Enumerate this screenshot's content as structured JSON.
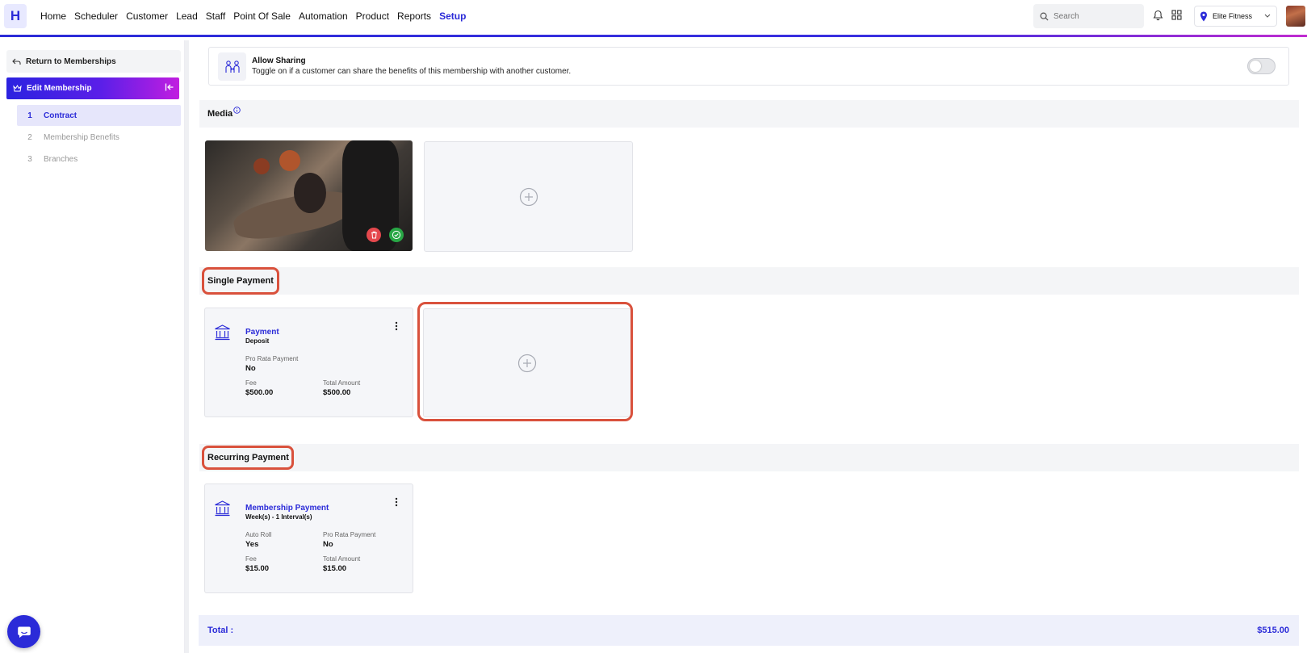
{
  "brand": {
    "logo_letter": "H",
    "accent": "#2b2bd8"
  },
  "nav": {
    "items": [
      "Home",
      "Scheduler",
      "Customer",
      "Lead",
      "Staff",
      "Point Of Sale",
      "Automation",
      "Product",
      "Reports",
      "Setup"
    ],
    "active": "Setup"
  },
  "search": {
    "placeholder": "Search"
  },
  "location": {
    "name": "Elite Fitness"
  },
  "sidebar": {
    "return_label": "Return to Memberships",
    "edit_label": "Edit Membership",
    "steps": [
      {
        "num": "1",
        "label": "Contract",
        "active": true
      },
      {
        "num": "2",
        "label": "Membership Benefits",
        "active": false
      },
      {
        "num": "3",
        "label": "Branches",
        "active": false
      }
    ]
  },
  "sharing": {
    "title": "Allow Sharing",
    "description": "Toggle on if a customer can share the benefits of this membership with another customer.",
    "enabled": false
  },
  "media": {
    "title": "Media",
    "info_icon": "info-icon"
  },
  "single_payment": {
    "title": "Single Payment",
    "card": {
      "title": "Payment",
      "subtitle": "Deposit",
      "pro_rata_label": "Pro Rata Payment",
      "pro_rata_value": "No",
      "fee_label": "Fee",
      "fee_value": "$500.00",
      "total_label": "Total Amount",
      "total_value": "$500.00"
    }
  },
  "recurring_payment": {
    "title": "Recurring Payment",
    "card": {
      "title": "Membership Payment",
      "subtitle": "Week(s) - 1 Interval(s)",
      "auto_roll_label": "Auto Roll",
      "auto_roll_value": "Yes",
      "pro_rata_label": "Pro Rata Payment",
      "pro_rata_value": "No",
      "fee_label": "Fee",
      "fee_value": "$15.00",
      "total_label": "Total Amount",
      "total_value": "$15.00"
    }
  },
  "total": {
    "label": "Total :",
    "value": "$515.00"
  },
  "colors": {
    "highlight": "#d9513c",
    "delete": "#e5484d",
    "confirm": "#28a745"
  }
}
